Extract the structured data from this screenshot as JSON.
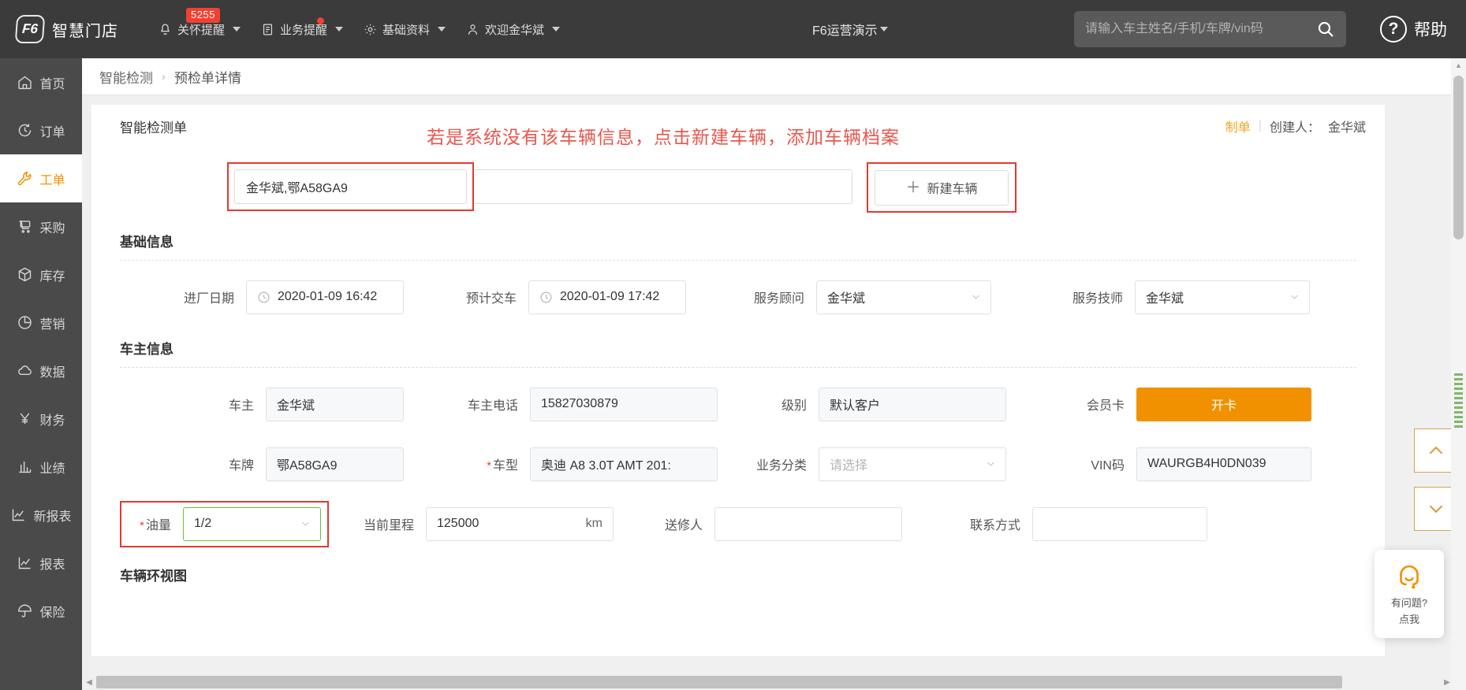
{
  "topbar": {
    "brand": {
      "logo_text": "F6",
      "name": "智慧门店"
    },
    "nav": [
      {
        "label": "关怀提醒",
        "icon": "bell-icon",
        "badge": "5255",
        "has_caret": true
      },
      {
        "label": "业务提醒",
        "icon": "list-icon",
        "dot": true,
        "has_caret": true
      },
      {
        "label": "基础资料",
        "icon": "gear-icon",
        "has_caret": true
      },
      {
        "label": "欢迎金华斌",
        "icon": "user-icon",
        "has_caret": true
      }
    ],
    "company": "F6运营演示",
    "search": {
      "placeholder": "请输入车主姓名/手机/车牌/vin码",
      "value": ""
    },
    "help": {
      "label": "帮助",
      "mark": "?"
    }
  },
  "sidebar": {
    "items": [
      {
        "label": "首页",
        "icon": "home-icon",
        "active": false
      },
      {
        "label": "订单",
        "icon": "clock-icon",
        "active": false
      },
      {
        "label": "工单",
        "icon": "wrench-icon",
        "active": true
      },
      {
        "label": "采购",
        "icon": "cart-icon",
        "active": false
      },
      {
        "label": "库存",
        "icon": "box-icon",
        "active": false
      },
      {
        "label": "营销",
        "icon": "pie-icon",
        "active": false
      },
      {
        "label": "数据",
        "icon": "cloud-icon",
        "active": false
      },
      {
        "label": "财务",
        "icon": "yuan-icon",
        "active": false
      },
      {
        "label": "业绩",
        "icon": "bar-chart-icon",
        "active": false
      },
      {
        "label": "新报表",
        "icon": "line-chart-icon",
        "active": false
      },
      {
        "label": "报表",
        "icon": "line-chart-icon",
        "active": false
      },
      {
        "label": "保险",
        "icon": "umbrella-icon",
        "active": false
      }
    ]
  },
  "breadcrumb": {
    "root": "智能检测",
    "separator": "›",
    "current": "预检单详情"
  },
  "card": {
    "title": "智能检测单",
    "status_link": "制单",
    "divider": "|",
    "creator_label": "创建人：",
    "creator_name": "金华斌",
    "annotation": "若是系统没有该车辆信息，点击新建车辆，添加车辆档案"
  },
  "vehicle_search": {
    "value": "金华斌,鄂A58GA9",
    "secondary_value": "",
    "new_vehicle_button": "新建车辆",
    "plus": "＋"
  },
  "basic_info": {
    "title": "基础信息",
    "fields": [
      {
        "label": "进厂日期",
        "value": "2020-01-09 16:42",
        "type": "datetime",
        "icon": "clock-icon"
      },
      {
        "label": "预计交车",
        "value": "2020-01-09 17:42",
        "type": "datetime",
        "icon": "clock-icon"
      },
      {
        "label": "服务顾问",
        "value": "金华斌",
        "type": "select"
      },
      {
        "label": "服务技师",
        "value": "金华斌",
        "type": "select"
      }
    ]
  },
  "owner_info": {
    "title": "车主信息",
    "row1": [
      {
        "label": "车主",
        "value": "金华斌",
        "type": "text"
      },
      {
        "label": "车主电话",
        "value": "15827030879",
        "type": "text"
      },
      {
        "label": "级别",
        "value": "默认客户",
        "type": "text"
      },
      {
        "label": "会员卡",
        "value": "开卡",
        "type": "button"
      }
    ],
    "row2": [
      {
        "label": "车牌",
        "value": "鄂A58GA9",
        "type": "text",
        "required": false
      },
      {
        "label": "车型",
        "value": "奥迪 A8 3.0T AMT 201:",
        "type": "text",
        "required": true
      },
      {
        "label": "业务分类",
        "value": "",
        "placeholder": "请选择",
        "type": "select",
        "required": false
      },
      {
        "label": "VIN码",
        "value": "WAURGB4H0DN039",
        "type": "text",
        "required": false
      }
    ],
    "row3": [
      {
        "label": "油量",
        "value": "1/2",
        "type": "select",
        "required": true,
        "highlighted": true
      },
      {
        "label": "当前里程",
        "value": "125000",
        "type": "text",
        "unit": "km"
      },
      {
        "label": "送修人",
        "value": "",
        "type": "text"
      },
      {
        "label": "联系方式",
        "value": "",
        "type": "text"
      }
    ]
  },
  "vehicle_view": {
    "title": "车辆环视图"
  },
  "edge_nav": {
    "up": "上一个",
    "down": "下一个"
  },
  "chat_widget": {
    "line1": "有问题?",
    "line2": "点我"
  },
  "colors": {
    "accent_orange": "#f29100",
    "annotation_red": "#e8574c",
    "badge_red": "#f04134",
    "topbar_bg": "#3b3b3b",
    "sidebar_bg": "#4a4a4a",
    "valid_green": "#67c23a"
  }
}
